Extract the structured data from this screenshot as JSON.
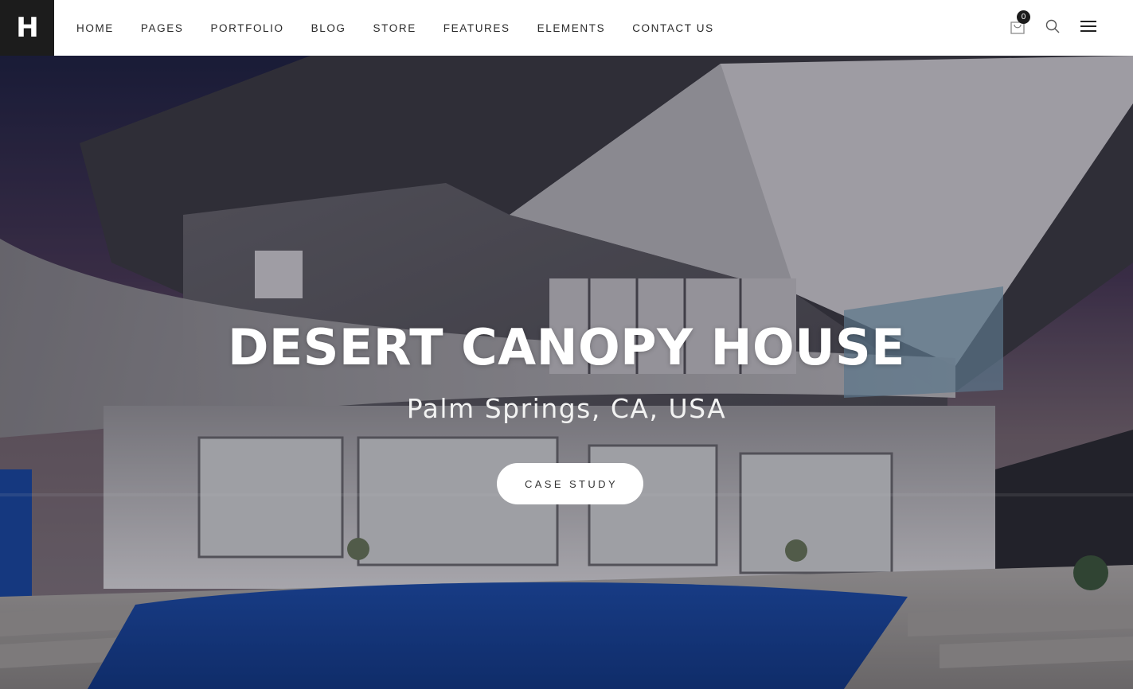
{
  "header": {
    "logo_letter": "H",
    "nav": [
      {
        "label": "HOME"
      },
      {
        "label": "PAGES"
      },
      {
        "label": "PORTFOLIO"
      },
      {
        "label": "BLOG"
      },
      {
        "label": "STORE"
      },
      {
        "label": "FEATURES"
      },
      {
        "label": "ELEMENTS"
      },
      {
        "label": "CONTACT US"
      }
    ],
    "cart_count": "0",
    "icons": [
      "shopping-bag-icon",
      "search-icon",
      "hamburger-menu-icon"
    ]
  },
  "hero": {
    "title": "DESERT CANOPY HOUSE",
    "subtitle": "Palm Springs, CA, USA",
    "button_label": "CASE STUDY"
  },
  "colors": {
    "header_bg": "#ffffff",
    "logo_bg": "#1c1c1c",
    "nav_text": "#2b2b2b",
    "hero_text": "#ffffff",
    "button_bg": "#ffffff",
    "button_text": "#333333"
  }
}
